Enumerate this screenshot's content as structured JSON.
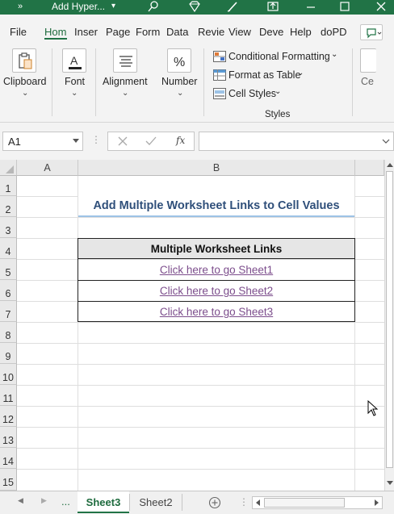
{
  "title_bar": {
    "more_icon": "»",
    "title": "Add Hyper...",
    "dropdown_icon": "▾"
  },
  "ribbon_tabs": [
    {
      "label": "File"
    },
    {
      "label": "Hom"
    },
    {
      "label": "Inser"
    },
    {
      "label": "Page"
    },
    {
      "label": "Form"
    },
    {
      "label": "Data"
    },
    {
      "label": "Revie"
    },
    {
      "label": "View"
    },
    {
      "label": "Deve"
    },
    {
      "label": "Help"
    },
    {
      "label": "doPD"
    }
  ],
  "ribbon": {
    "clipboard": "Clipboard",
    "font": "Font",
    "alignment": "Alignment",
    "number": "Number",
    "conditional_formatting": "Conditional Formatting",
    "format_as_table": "Format as Table",
    "cell_styles": "Cell Styles",
    "styles_group": "Styles",
    "cells_truncated": "Ce"
  },
  "formula_bar": {
    "name_box": "A1",
    "fx": "fx",
    "formula_value": ""
  },
  "columns": [
    "A",
    "B"
  ],
  "rows": [
    "1",
    "2",
    "3",
    "4",
    "5",
    "6",
    "7",
    "8",
    "9",
    "10",
    "11",
    "12",
    "13",
    "14",
    "15"
  ],
  "sheet": {
    "title": "Add Multiple Worksheet Links to Cell Values",
    "table_header": "Multiple Worksheet Links",
    "links": [
      "Click here to go Sheet1",
      "Click here to go Sheet2",
      "Click here to go Sheet3"
    ]
  },
  "sheet_tabs": {
    "ellipsis": "...",
    "tabs": [
      "Sheet3",
      "Sheet2"
    ],
    "active": "Sheet3"
  },
  "colors": {
    "excel_green": "#217346",
    "title_text": "#2f4f7a",
    "link_text": "#7c4d8c",
    "header_fill": "#e6e6e6"
  }
}
